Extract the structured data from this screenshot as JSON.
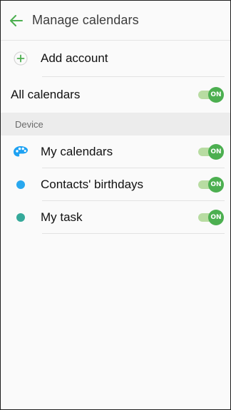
{
  "header": {
    "title": "Manage calendars",
    "back_icon": "arrow-left-icon",
    "accent": "#4caf50"
  },
  "add_account": {
    "label": "Add account",
    "icon": "plus-circle-icon"
  },
  "all_calendars": {
    "label": "All calendars",
    "toggle_text": "ON"
  },
  "section": {
    "title": "Device"
  },
  "calendars": [
    {
      "label": "My calendars",
      "icon": "palette-icon",
      "color": "#1da1f2",
      "toggle_text": "ON"
    },
    {
      "label": "Contacts' birthdays",
      "icon": "dot-icon",
      "color": "#29a8ef",
      "toggle_text": "ON"
    },
    {
      "label": "My task",
      "icon": "dot-icon",
      "color": "#35a99a",
      "toggle_text": "ON"
    }
  ]
}
